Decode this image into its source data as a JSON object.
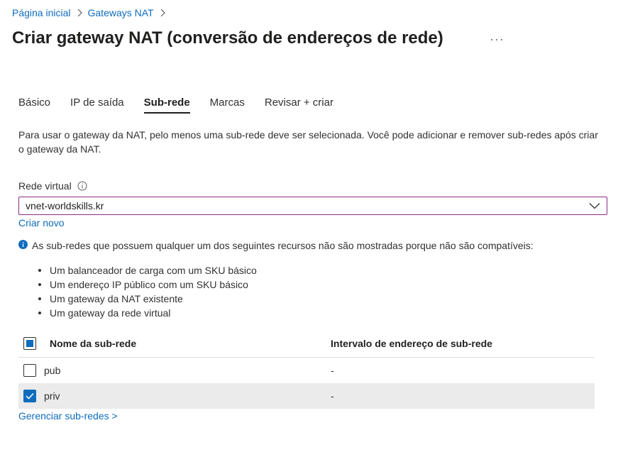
{
  "breadcrumb": {
    "items": [
      "Página inicial",
      "Gateways NAT"
    ]
  },
  "page": {
    "title": "Criar gateway NAT (conversão de endereços de rede)",
    "more_icon": "ellipsis-icon"
  },
  "tabs": [
    {
      "label": "Básico",
      "active": false
    },
    {
      "label": "IP de saída",
      "active": false
    },
    {
      "label": "Sub-rede",
      "active": true
    },
    {
      "label": "Marcas",
      "active": false
    },
    {
      "label": "Revisar + criar",
      "active": false
    }
  ],
  "description": "Para usar o gateway da NAT, pelo menos uma sub-rede deve ser selecionada. Você pode adicionar e remover sub-redes após criar o gateway da NAT.",
  "vnet": {
    "label": "Rede virtual",
    "value": "vnet-worldskills.kr",
    "create_new": "Criar novo"
  },
  "note": {
    "text": "As sub-redes que possuem qualquer um dos seguintes recursos não são mostradas porque não são compatíveis:",
    "items": [
      "Um balanceador de carga com um SKU básico",
      "Um endereço IP público com um SKU básico",
      "Um gateway da NAT existente",
      "Um gateway da rede virtual"
    ]
  },
  "table": {
    "col_name": "Nome da sub-rede",
    "col_range": "Intervalo de endereço de sub-rede",
    "rows": [
      {
        "name": "pub",
        "range": "-",
        "checked": false
      },
      {
        "name": "priv",
        "range": "-",
        "checked": true
      }
    ]
  },
  "manage_link": "Gerenciar sub-redes >",
  "colors": {
    "link": "#0f6cbd",
    "select_border": "#8a2c86",
    "selected_row": "#ebebeb"
  }
}
